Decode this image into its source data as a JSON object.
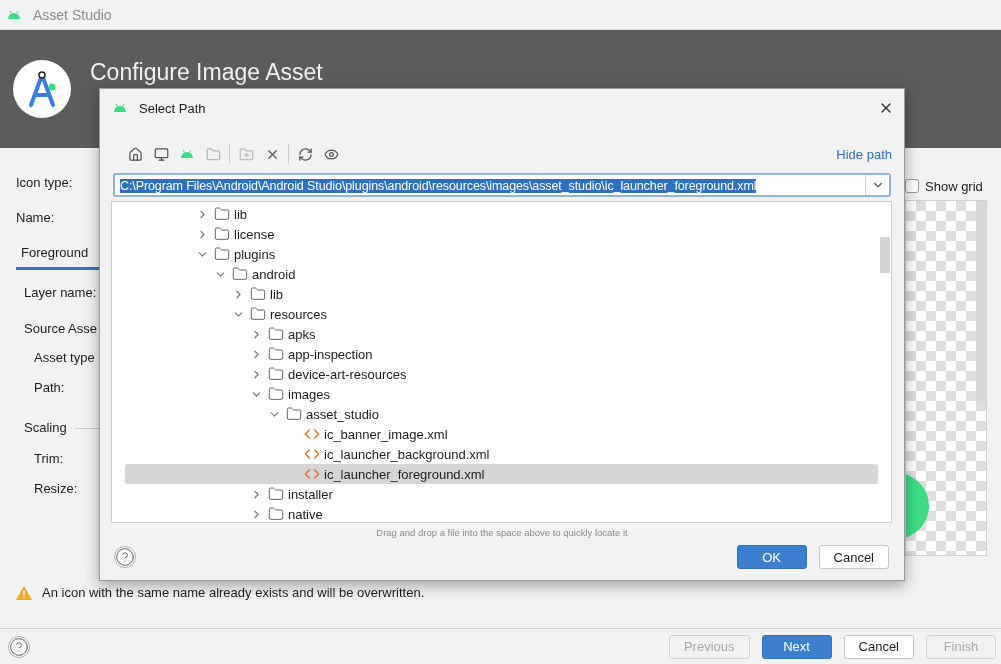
{
  "window": {
    "title": "Asset Studio"
  },
  "header": {
    "title": "Configure Image Asset"
  },
  "form_rows": [
    {
      "kind": "label",
      "text": "Icon type:"
    },
    {
      "kind": "label",
      "text": "Name:"
    },
    {
      "kind": "tab",
      "text": "Foreground",
      "selected": true
    },
    {
      "kind": "field",
      "text": "Layer name:"
    },
    {
      "kind": "heading",
      "text": "Source Asse"
    },
    {
      "kind": "sublabel",
      "text": "Asset type"
    },
    {
      "kind": "sublabel",
      "text": "Path:"
    },
    {
      "kind": "rule_heading",
      "text": "Scaling"
    },
    {
      "kind": "sublabel",
      "text": "Trim:"
    },
    {
      "kind": "sublabel",
      "text": "Resize:"
    }
  ],
  "preview": {
    "show_grid": {
      "label": "Show grid",
      "checked": false
    }
  },
  "warning": {
    "text": "An icon with the same name already exists and will be overwritten."
  },
  "footer_buttons": [
    {
      "label": "Previous",
      "kind": "default",
      "disabled": true
    },
    {
      "label": "Next",
      "kind": "primary",
      "disabled": false
    },
    {
      "label": "Cancel",
      "kind": "default",
      "disabled": false
    },
    {
      "label": "Finish",
      "kind": "default",
      "disabled": true
    }
  ],
  "dialog": {
    "title": "Select Path",
    "toolbar": [
      {
        "kind": "home",
        "disabled": false
      },
      {
        "kind": "desktop",
        "disabled": false
      },
      {
        "kind": "android",
        "disabled": false
      },
      {
        "kind": "folder_box",
        "disabled": true
      },
      {
        "kind": "separator"
      },
      {
        "kind": "new_folder",
        "disabled": true
      },
      {
        "kind": "delete",
        "disabled": false
      },
      {
        "kind": "separator"
      },
      {
        "kind": "refresh",
        "disabled": false
      },
      {
        "kind": "eye",
        "disabled": false
      }
    ],
    "hide_path_link": "Hide path",
    "path": "C:\\Program Files\\Android\\Android Studio\\plugins\\android\\resources\\images\\asset_studio\\ic_launcher_foreground.xml",
    "tree": [
      {
        "kind": "folder",
        "name": "lib",
        "expanded": false,
        "selected": false
      },
      {
        "kind": "folder",
        "name": "license",
        "expanded": false,
        "selected": false
      },
      {
        "kind": "folder",
        "name": "plugins",
        "expanded": true,
        "selected": false,
        "children": [
          {
            "kind": "folder",
            "name": "android",
            "expanded": true,
            "selected": false,
            "children": [
              {
                "kind": "folder",
                "name": "lib",
                "expanded": false,
                "selected": false
              },
              {
                "kind": "folder",
                "name": "resources",
                "expanded": true,
                "selected": false,
                "children": [
                  {
                    "kind": "folder",
                    "name": "apks",
                    "expanded": false,
                    "selected": false
                  },
                  {
                    "kind": "folder",
                    "name": "app-inspection",
                    "expanded": false,
                    "selected": false
                  },
                  {
                    "kind": "folder",
                    "name": "device-art-resources",
                    "expanded": false,
                    "selected": false
                  },
                  {
                    "kind": "folder",
                    "name": "images",
                    "expanded": true,
                    "selected": false,
                    "children": [
                      {
                        "kind": "folder",
                        "name": "asset_studio",
                        "expanded": true,
                        "selected": false,
                        "children": [
                          {
                            "kind": "file",
                            "name": "ic_banner_image.xml",
                            "selected": false
                          },
                          {
                            "kind": "file",
                            "name": "ic_launcher_background.xml",
                            "selected": false
                          },
                          {
                            "kind": "file",
                            "name": "ic_launcher_foreground.xml",
                            "selected": true
                          }
                        ]
                      }
                    ]
                  },
                  {
                    "kind": "folder",
                    "name": "installer",
                    "expanded": false,
                    "selected": false
                  },
                  {
                    "kind": "folder",
                    "name": "native",
                    "expanded": false,
                    "selected": false
                  }
                ]
              }
            ]
          }
        ]
      }
    ],
    "hint": "Drag and drop a file into the space above to quickly locate it",
    "buttons": [
      {
        "label": "OK",
        "kind": "primary"
      },
      {
        "label": "Cancel",
        "kind": "default"
      }
    ]
  }
}
